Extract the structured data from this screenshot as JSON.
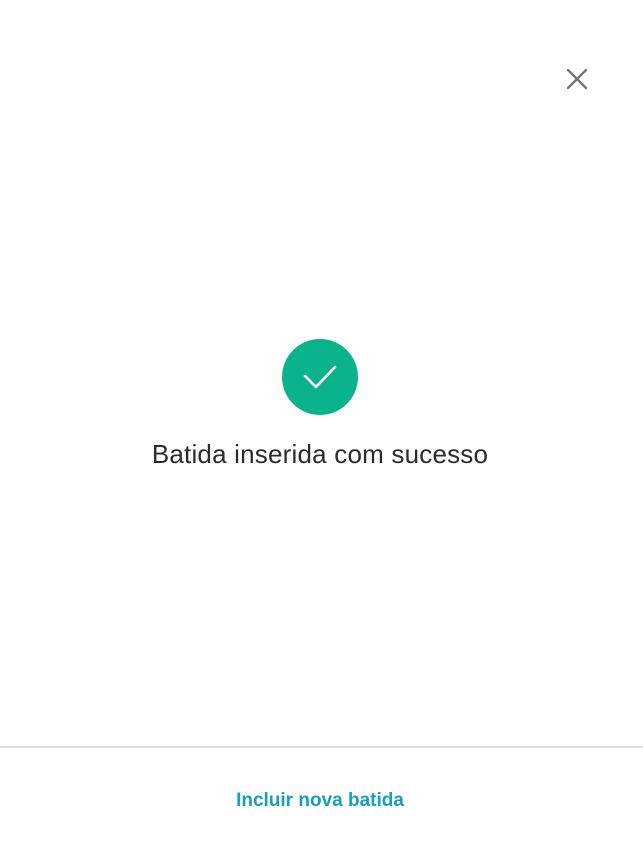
{
  "dialog": {
    "close_icon": "close-icon",
    "success_icon": "check-icon",
    "message": "Batida inserida com sucesso",
    "footer_action_label": "Incluir nova batida"
  },
  "colors": {
    "success": "#0bb38d",
    "link": "#1a9ebd",
    "text": "#2b2b2b",
    "close_icon": "#777777",
    "divider": "#dedede"
  }
}
